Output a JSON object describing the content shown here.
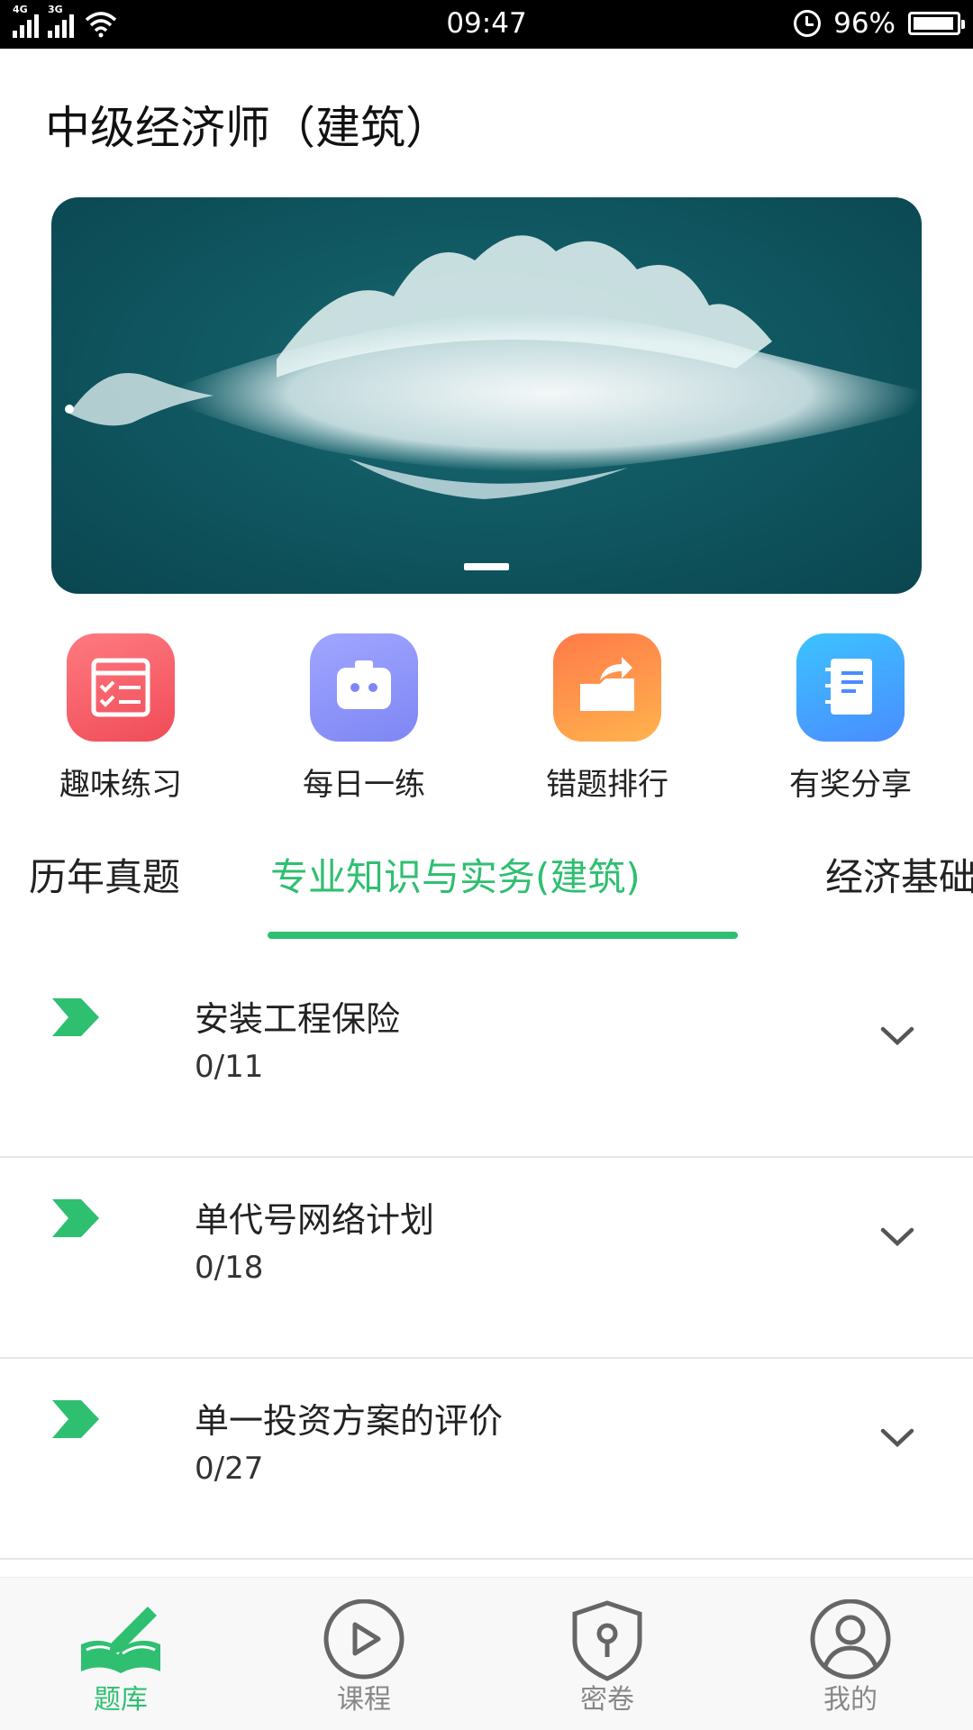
{
  "status_bar": {
    "network_1": "4G",
    "network_2": "3G",
    "time": "09:47",
    "battery": "96%",
    "battery_level": 0.96,
    "icons": [
      "signal-icon",
      "wifi-icon",
      "alarm-icon",
      "battery-icon"
    ]
  },
  "header": {
    "title": "中级经济师（建筑）"
  },
  "banner": {
    "page_count": 1,
    "active_page": 1
  },
  "quick_actions": [
    {
      "label": "趣味练习",
      "icon": "practice-sheet-icon",
      "color": "#f04c58"
    },
    {
      "label": "每日一练",
      "icon": "robot-box-icon",
      "color": "#7e86f4"
    },
    {
      "label": "错题排行",
      "icon": "folder-share-icon",
      "color": "#ff8a48"
    },
    {
      "label": "有奖分享",
      "icon": "notebook-icon",
      "color": "#3ea6ff"
    }
  ],
  "tabs": [
    {
      "label": "历年真题",
      "active": false
    },
    {
      "label": "专业知识与实务(建筑)",
      "active": true
    },
    {
      "label": "经济基础",
      "active": false
    }
  ],
  "chapters": [
    {
      "title": "安装工程保险",
      "progress": "0/11"
    },
    {
      "title": "单代号网络计划",
      "progress": "0/18"
    },
    {
      "title": "单一投资方案的评价",
      "progress": "0/27"
    }
  ],
  "bottom_nav": [
    {
      "label": "题库",
      "icon": "book-pen-icon",
      "active": true
    },
    {
      "label": "课程",
      "icon": "play-circle-icon",
      "active": false
    },
    {
      "label": "密卷",
      "icon": "shield-lock-icon",
      "active": false
    },
    {
      "label": "我的",
      "icon": "user-circle-icon",
      "active": false
    }
  ],
  "colors": {
    "accent": "#2fbf71",
    "inactive": "#888888"
  }
}
